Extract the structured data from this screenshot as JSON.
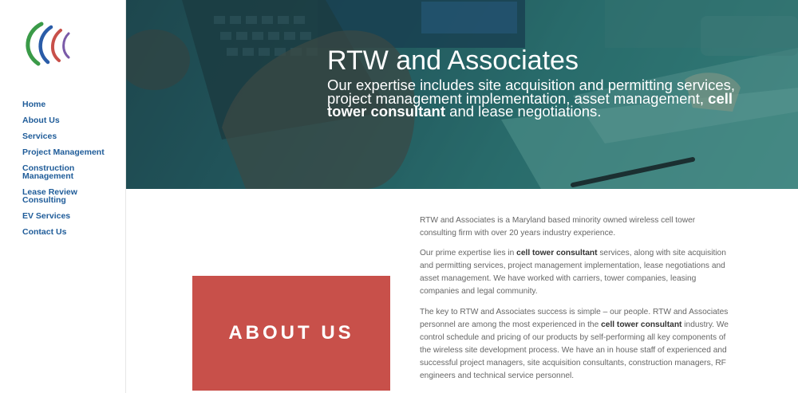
{
  "brand": {
    "logo_icon": "rtw-swoosh-logo",
    "colors": {
      "green": "#3a9a48",
      "blue": "#2a5ca8",
      "red": "#c8504a",
      "nav": "#1f5c99"
    }
  },
  "nav": {
    "items": [
      {
        "label": "Home"
      },
      {
        "label": "About Us"
      },
      {
        "label": "Services"
      },
      {
        "label": "Project Management"
      },
      {
        "label": "Construction Management"
      },
      {
        "label": "Lease Review Consulting"
      },
      {
        "label": "EV Services"
      },
      {
        "label": "Contact Us"
      }
    ]
  },
  "hero": {
    "title": "RTW and Associates",
    "subtitle_before": "Our expertise includes site acquisition and permitting services, project management implementation, asset management, ",
    "subtitle_bold": "cell tower consultant",
    "subtitle_after": " and lease negotiations."
  },
  "about": {
    "heading": "ABOUT US",
    "p1": "RTW and Associates is a Maryland based minority owned wireless cell tower consulting firm with over 20 years industry experience.",
    "p2_before": "Our prime expertise lies in ",
    "p2_bold": "cell tower consultant",
    "p2_after": " services, along with site acquisition and permitting services, project management implementation, lease negotiations and asset management. We have worked with carriers, tower companies, leasing companies and legal community.",
    "p3_before": "The key to RTW and Associates success is simple – our people. RTW and Associates personnel are among the most experienced in the ",
    "p3_bold": "cell tower consultant",
    "p3_after": " industry. We control schedule and pricing of our products by self-performing all key components of the wireless site development process. We have an in house staff of experienced and successful project managers, site acquisition consultants, construction managers, RF engineers and technical service personnel."
  }
}
